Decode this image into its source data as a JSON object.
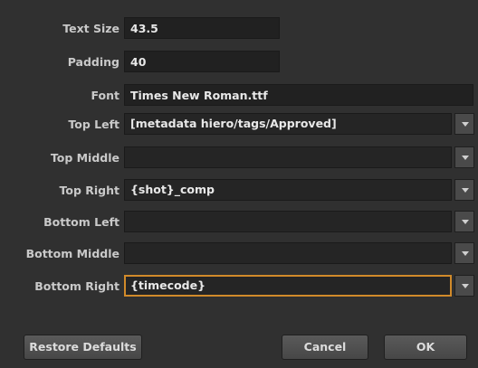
{
  "fields": {
    "text_size": {
      "label": "Text Size",
      "value": "43.5"
    },
    "padding": {
      "label": "Padding",
      "value": "40"
    },
    "font": {
      "label": "Font",
      "value": "Times New Roman.ttf"
    },
    "top_left": {
      "label": "Top Left",
      "value": "[metadata hiero/tags/Approved]"
    },
    "top_middle": {
      "label": "Top Middle",
      "value": ""
    },
    "top_right": {
      "label": "Top Right",
      "value": "{shot}_comp"
    },
    "bottom_left": {
      "label": "Bottom Left",
      "value": ""
    },
    "bottom_middle": {
      "label": "Bottom Middle",
      "value": ""
    },
    "bottom_right": {
      "label": "Bottom Right",
      "value": "{timecode}"
    }
  },
  "buttons": {
    "restore_defaults": "Restore Defaults",
    "cancel": "Cancel",
    "ok": "OK"
  },
  "colors": {
    "background": "#303030",
    "focus_border": "#d18a2a"
  }
}
